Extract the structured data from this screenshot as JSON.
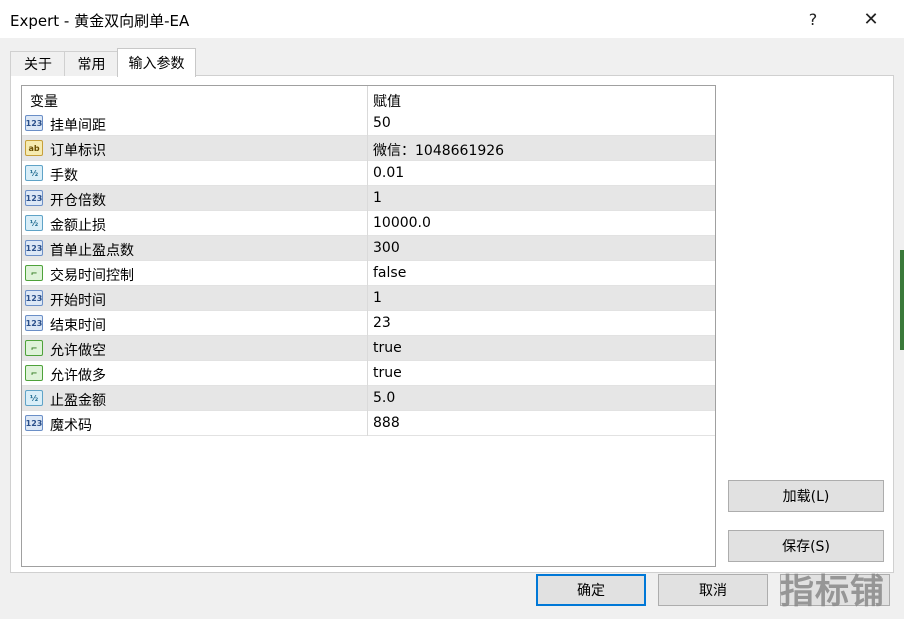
{
  "window": {
    "title": "Expert - 黄金双向刷单-EA",
    "help": "?",
    "close": "✕"
  },
  "tabs": [
    {
      "label": "关于"
    },
    {
      "label": "常用"
    },
    {
      "label": "输入参数"
    }
  ],
  "grid": {
    "headers": {
      "variable": "变量",
      "value": "赋值"
    },
    "rows": [
      {
        "type": "int",
        "icon_text": "123",
        "name": "挂单间距",
        "value": "50"
      },
      {
        "type": "string",
        "icon_text": "ab",
        "name": "订单标识",
        "value": "微信：1048661926"
      },
      {
        "type": "double",
        "icon_text": "½",
        "name": "手数",
        "value": "0.01"
      },
      {
        "type": "int",
        "icon_text": "123",
        "name": "开仓倍数",
        "value": "1"
      },
      {
        "type": "double",
        "icon_text": "½",
        "name": "金额止损",
        "value": "10000.0"
      },
      {
        "type": "int",
        "icon_text": "123",
        "name": "首单止盈点数",
        "value": "300"
      },
      {
        "type": "bool",
        "icon_text": "⌐",
        "name": "交易时间控制",
        "value": "false"
      },
      {
        "type": "int",
        "icon_text": "123",
        "name": "开始时间",
        "value": "1"
      },
      {
        "type": "int",
        "icon_text": "123",
        "name": "结束时间",
        "value": "23"
      },
      {
        "type": "bool",
        "icon_text": "⌐",
        "name": "允许做空",
        "value": "true"
      },
      {
        "type": "bool",
        "icon_text": "⌐",
        "name": "允许做多",
        "value": "true"
      },
      {
        "type": "double",
        "icon_text": "½",
        "name": "止盈金额",
        "value": "5.0"
      },
      {
        "type": "int",
        "icon_text": "123",
        "name": "魔术码",
        "value": "888"
      }
    ]
  },
  "buttons": {
    "load": "加载(L)",
    "save": "保存(S)",
    "ok": "确定",
    "cancel": "取消",
    "reset": ""
  },
  "watermark": "指标铺"
}
